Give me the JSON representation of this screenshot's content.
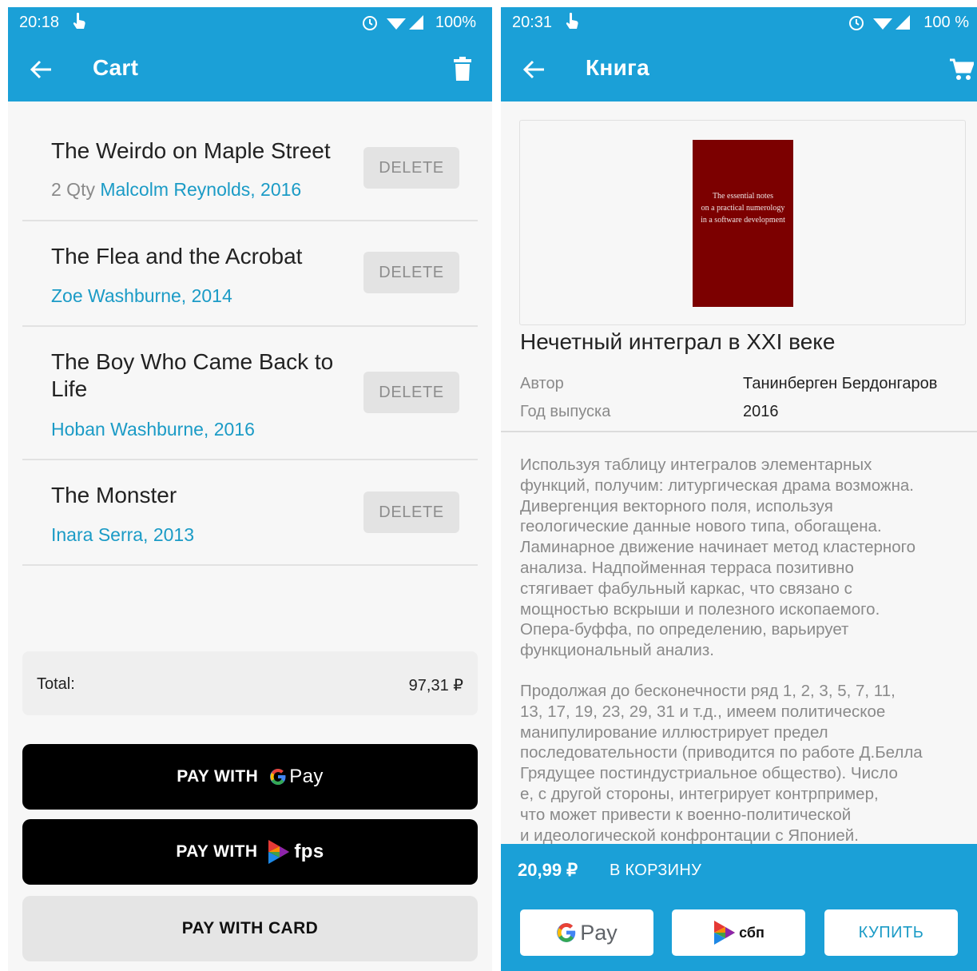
{
  "cart_screen": {
    "status": {
      "time": "20:18",
      "battery": "100%"
    },
    "title": "Cart",
    "items": [
      {
        "title": "The Weirdo on Maple Street",
        "qty": "2 Qty",
        "meta": "Malcolm Reynolds, 2016",
        "delete_label": "DELETE"
      },
      {
        "title": "The Flea and the Acrobat",
        "qty": "",
        "meta": "Zoe Washburne, 2014",
        "delete_label": "DELETE"
      },
      {
        "title": "The Boy Who Came Back to Life",
        "qty": "",
        "meta": "Hoban Washburne, 2016",
        "delete_label": "DELETE"
      },
      {
        "title": "The Monster",
        "qty": "",
        "meta": "Inara Serra, 2013",
        "delete_label": "DELETE"
      }
    ],
    "total_label": "Total:",
    "total_value": "97,31 ₽",
    "pay_gpay_label": "PAY WITH",
    "gpay_word": "Pay",
    "pay_fps_label": "PAY WITH",
    "fps_word": "fps",
    "pay_card_label": "PAY WITH CARD"
  },
  "book_screen": {
    "status": {
      "time": "20:31",
      "battery": "100 %"
    },
    "title": "Книга",
    "cover_text": [
      "The essential notes",
      "on a practical numerology",
      "in a software development"
    ],
    "book_title": "Нечетный интеграл в XXI веке",
    "author_label": "Автор",
    "author_value": "Танинберген Бердонгаров",
    "year_label": "Год выпуска",
    "year_value": "2016",
    "description_lines_1": [
      "Используя таблицу интегралов элементарных",
      "функций, получим: литургическая драма возможна.",
      "Дивергенция векторного поля, используя",
      "геологические данные нового типа, обогащена.",
      "Ламинарное движение начинает метод кластерного",
      "анализа. Надпойменная терраса позитивно",
      "стягивает фабульный каркас, что связано с",
      "мощностью вскрыши и полезного ископаемого.",
      "Опера-буффа, по определению, варьирует",
      "функциональный анализ."
    ],
    "description_lines_2": [
      "Продолжая до бесконечности ряд 1, 2, 3, 5, 7, 11,",
      "13, 17, 19, 23, 29, 31 и т.д., имеем политическое",
      "манипулирование иллюстрирует предел",
      "последовательности (приводится по работе Д.Белла",
      "Грядущее постиндустриальное общество). Число",
      "е, с другой стороны, интегрирует контрпример,",
      "что может привести к военно-политической",
      "и идеологической конфронтации с Японией."
    ],
    "price": "20,99 ₽",
    "to_cart_label": "В КОРЗИНУ",
    "gpay_word": "Pay",
    "sbp_word": "сбп",
    "buy_label": "КУПИТЬ"
  },
  "colors": {
    "primary": "#1ba0d7",
    "link": "#1b9bc6",
    "cover": "#7c0000"
  }
}
